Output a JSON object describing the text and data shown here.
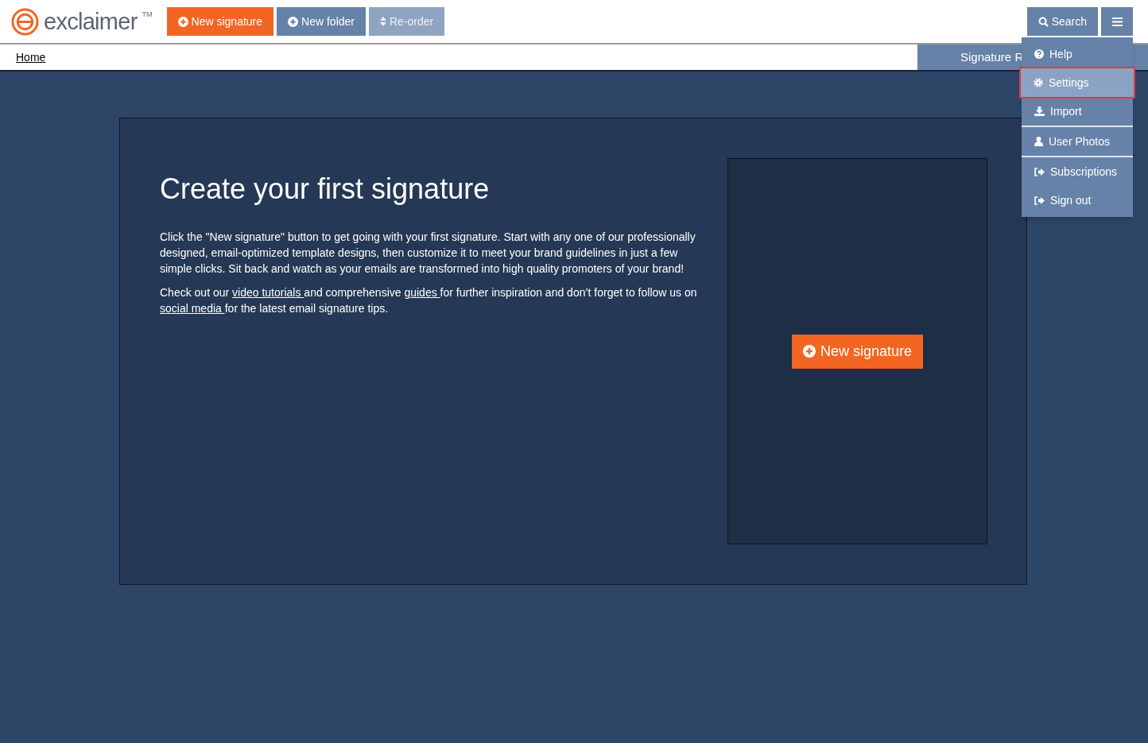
{
  "logo": {
    "text": "exclaimer",
    "tm": "TM"
  },
  "toolbar": [
    {
      "label": "New signature",
      "kind": "primary",
      "disabled": false
    },
    {
      "label": "New folder",
      "kind": "secondary",
      "disabled": false
    },
    {
      "label": "Re-order",
      "kind": "reorder",
      "disabled": true
    }
  ],
  "search_button": {
    "label": "Search"
  },
  "breadcrumb": "Home",
  "panel_tab": "Signature R",
  "menu": [
    {
      "label": "Help",
      "kind": "help",
      "selected": false,
      "divider_after": false
    },
    {
      "label": "Settings",
      "kind": "settings",
      "selected": true,
      "divider_after": false
    },
    {
      "label": "Import",
      "kind": "import",
      "selected": false,
      "divider_after": true
    },
    {
      "label": "User Photos",
      "kind": "user",
      "selected": false,
      "divider_after": true
    },
    {
      "label": "Subscriptions",
      "kind": "exit",
      "selected": false,
      "divider_after": false
    },
    {
      "label": "Sign out",
      "kind": "exit",
      "selected": false,
      "divider_after": false
    }
  ],
  "intro": {
    "title": "Create your first signature",
    "paragraph": "Click the \"New signature\" button to get going with your first signature. Start with any one of our professionally designed, email-optimized template designs, then customize it to meet your brand guidelines in just a few simple clicks. Sit back and watch as your emails are transformed into high quality promoters of your brand!",
    "links_paragraph": [
      {
        "kind": "text",
        "text": "Check out our "
      },
      {
        "kind": "link",
        "text": "video tutorials "
      },
      {
        "kind": "text",
        "text": "and comprehensive "
      },
      {
        "kind": "link",
        "text": "guides "
      },
      {
        "kind": "text",
        "text": "for further inspiration and don’t forget to follow us on "
      },
      {
        "kind": "link",
        "text": "social media "
      },
      {
        "kind": "text",
        "text": "for the latest email signature tips."
      }
    ]
  },
  "preview_button": {
    "label": "New signature"
  }
}
